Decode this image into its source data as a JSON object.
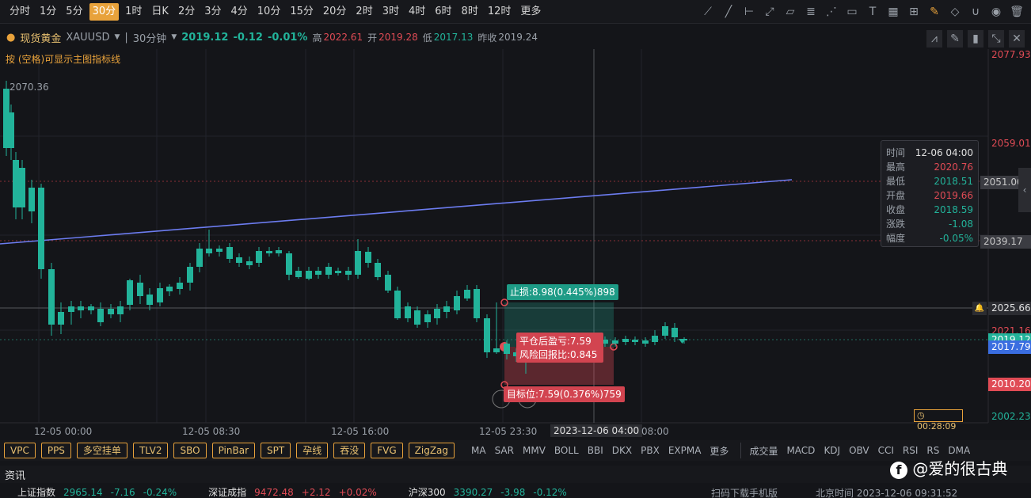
{
  "timeframes": [
    "分时",
    "1分",
    "5分",
    "30分",
    "1时",
    "日K",
    "2分",
    "3分",
    "4分",
    "10分",
    "15分",
    "20分",
    "2时",
    "3时",
    "4时",
    "6时",
    "8时",
    "12时",
    "更多"
  ],
  "active_timeframe": "30分",
  "symbol": {
    "name": "现货黄金",
    "code": "XAUUSD",
    "period": "30分钟",
    "price": "2019.12",
    "change": "-0.12",
    "change_pct": "-0.01%",
    "high_label": "高",
    "high": "2022.61",
    "open_label": "开",
    "open": "2019.28",
    "low_label": "低",
    "low": "2017.13",
    "prev_label": "昨收",
    "prev": "2019.24"
  },
  "hint": "按 (空格)可显示主图指标线",
  "price_axis": [
    "2077.93",
    "2059.01",
    "2051.00",
    "2039.17",
    "2025.66",
    "2021.16",
    "2019.12",
    "2017.79",
    "2010.20",
    "2002.23"
  ],
  "peak_label": "2070.36",
  "time_axis": [
    "12-05 00:00",
    "12-05 08:30",
    "12-05 16:00",
    "12-05 23:30",
    "2023-12-06 04:00",
    "08:00"
  ],
  "countdown": "00:28:09",
  "tooltip": {
    "rows": [
      {
        "k": "时间",
        "v": "12-06 04:00"
      },
      {
        "k": "最高",
        "v": "2020.76"
      },
      {
        "k": "最低",
        "v": "2018.51"
      },
      {
        "k": "开盘",
        "v": "2019.66"
      },
      {
        "k": "收盘",
        "v": "2018.59"
      },
      {
        "k": "涨跌",
        "v": "-1.08"
      },
      {
        "k": "幅度",
        "v": "-0.05%"
      }
    ]
  },
  "position": {
    "stop_loss": "止损:8.98(0.445%)898",
    "pnl": "平仓后盈亏:7.59",
    "risk_ratio": "风险回报比:0.845",
    "target": "目标位:7.59(0.376%)759"
  },
  "indicators_main": [
    "VPC",
    "PPS",
    "多空挂单",
    "TLV2",
    "SBO",
    "PinBar",
    "SPT",
    "孕线",
    "吞没",
    "FVG",
    "ZigZag"
  ],
  "indicators_overlay": [
    "MA",
    "SAR",
    "MMV",
    "BOLL",
    "BBI",
    "DKX",
    "PBX",
    "EXPMA",
    "更多"
  ],
  "indicators_sub": [
    "成交量",
    "MACD",
    "KDJ",
    "OBV",
    "CCI",
    "RSI",
    "RS",
    "DMA"
  ],
  "news_label": "资讯",
  "watermark": "@爱的很古典",
  "tickers": [
    {
      "name": "上证指数",
      "price": "2965.14",
      "chg": "-7.16",
      "pct": "-0.24%"
    },
    {
      "name": "深证成指",
      "price": "9472.48",
      "chg": "+2.12",
      "pct": "+0.02%"
    },
    {
      "name": "沪深300",
      "price": "3390.27",
      "chg": "-3.98",
      "pct": "-0.12%"
    }
  ],
  "footer_right": "扫码下载手机版",
  "clock": "北京时间 2023-12-06 09:31:52",
  "colors": {
    "up": "#e04b55",
    "down": "#22b39a",
    "accent": "#e8a23b",
    "trendline": "#6c7cf0"
  }
}
